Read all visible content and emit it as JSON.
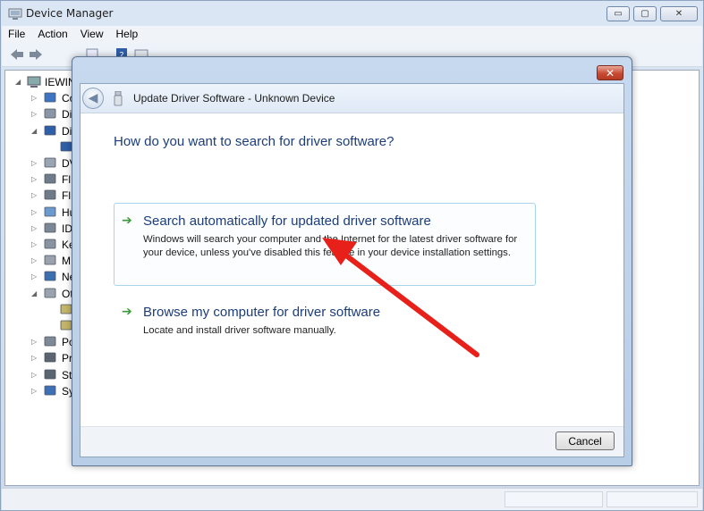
{
  "main_window": {
    "title": "Device Manager",
    "caption_buttons": {
      "minimize": "▭",
      "maximize": "▢",
      "close": "✕"
    },
    "menu": [
      "File",
      "Action",
      "View",
      "Help"
    ]
  },
  "tree": {
    "root_label": "IEWIN",
    "items": [
      {
        "label": "Co",
        "icon": "computer-icon"
      },
      {
        "label": "Di",
        "icon": "disk-drive-icon"
      },
      {
        "label": "Di",
        "icon": "display-adapter-icon"
      },
      {
        "label": "",
        "icon": "display-device-icon"
      },
      {
        "label": "DV",
        "icon": "dvd-drive-icon"
      },
      {
        "label": "Fl",
        "icon": "floppy-controller-icon"
      },
      {
        "label": "Fl",
        "icon": "floppy-drive-icon"
      },
      {
        "label": "Hu",
        "icon": "hid-icon"
      },
      {
        "label": "ID",
        "icon": "ide-controller-icon"
      },
      {
        "label": "Ke",
        "icon": "keyboard-icon"
      },
      {
        "label": "M",
        "icon": "mouse-icon"
      },
      {
        "label": "Ne",
        "icon": "network-adapter-icon"
      },
      {
        "label": "Ot",
        "icon": "other-devices-icon"
      },
      {
        "label": "",
        "icon": "unknown-device-icon"
      },
      {
        "label": "",
        "icon": "unknown-device-icon"
      },
      {
        "label": "Po",
        "icon": "ports-icon"
      },
      {
        "label": "Pr",
        "icon": "processor-icon"
      },
      {
        "label": "St",
        "icon": "storage-controller-icon"
      },
      {
        "label": "Sy",
        "icon": "system-devices-icon"
      }
    ]
  },
  "dialog": {
    "title": "Update Driver Software - Unknown Device",
    "close_label": "✕",
    "back_label": "◀",
    "heading": "How do you want to search for driver software?",
    "options": [
      {
        "title": "Search automatically for updated driver software",
        "description": "Windows will search your computer and the Internet for the latest driver software for your device, unless you've disabled this feature in your device installation settings."
      },
      {
        "title": "Browse my computer for driver software",
        "description": "Locate and install driver software manually."
      }
    ],
    "arrow_glyph": "➔",
    "cancel_label": "Cancel"
  },
  "annotation": {
    "color": "#e8201a"
  }
}
